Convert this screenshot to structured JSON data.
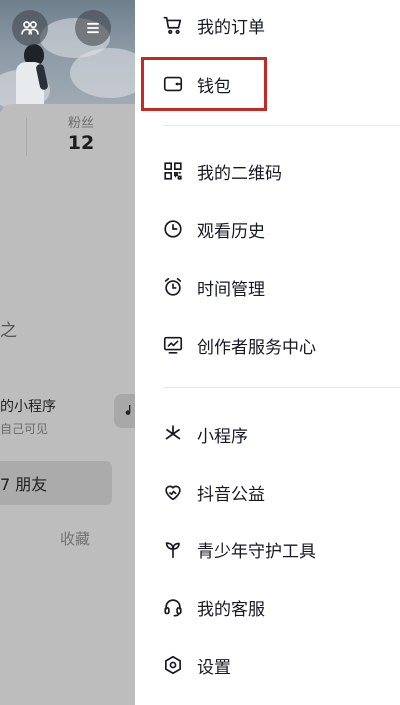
{
  "profile": {
    "fans_label": "粉丝",
    "fans_value": "12",
    "partial_heading": "之",
    "mini_program_title": "的小程序",
    "mini_program_subtitle": "自己可见",
    "friends_label": "7 朋友",
    "favorites_tab": "收藏"
  },
  "menu": {
    "items": [
      {
        "label": "我的订单",
        "icon": "cart-icon"
      },
      {
        "label": "钱包",
        "icon": "wallet-icon",
        "highlighted": true
      },
      {
        "label": "我的二维码",
        "icon": "qr-code-icon"
      },
      {
        "label": "观看历史",
        "icon": "clock-icon"
      },
      {
        "label": "时间管理",
        "icon": "alarm-clock-icon"
      },
      {
        "label": "创作者服务中心",
        "icon": "monitor-chart-icon"
      },
      {
        "label": "小程序",
        "icon": "asterisk-icon"
      },
      {
        "label": "抖音公益",
        "icon": "heart-icon"
      },
      {
        "label": "青少年守护工具",
        "icon": "sprout-icon"
      },
      {
        "label": "我的客服",
        "icon": "headset-icon"
      },
      {
        "label": "设置",
        "icon": "hexagon-gear-icon"
      }
    ]
  },
  "colors": {
    "highlight": "#c42a24",
    "text": "#161823",
    "dim_overlay": "#b9b9b9"
  }
}
